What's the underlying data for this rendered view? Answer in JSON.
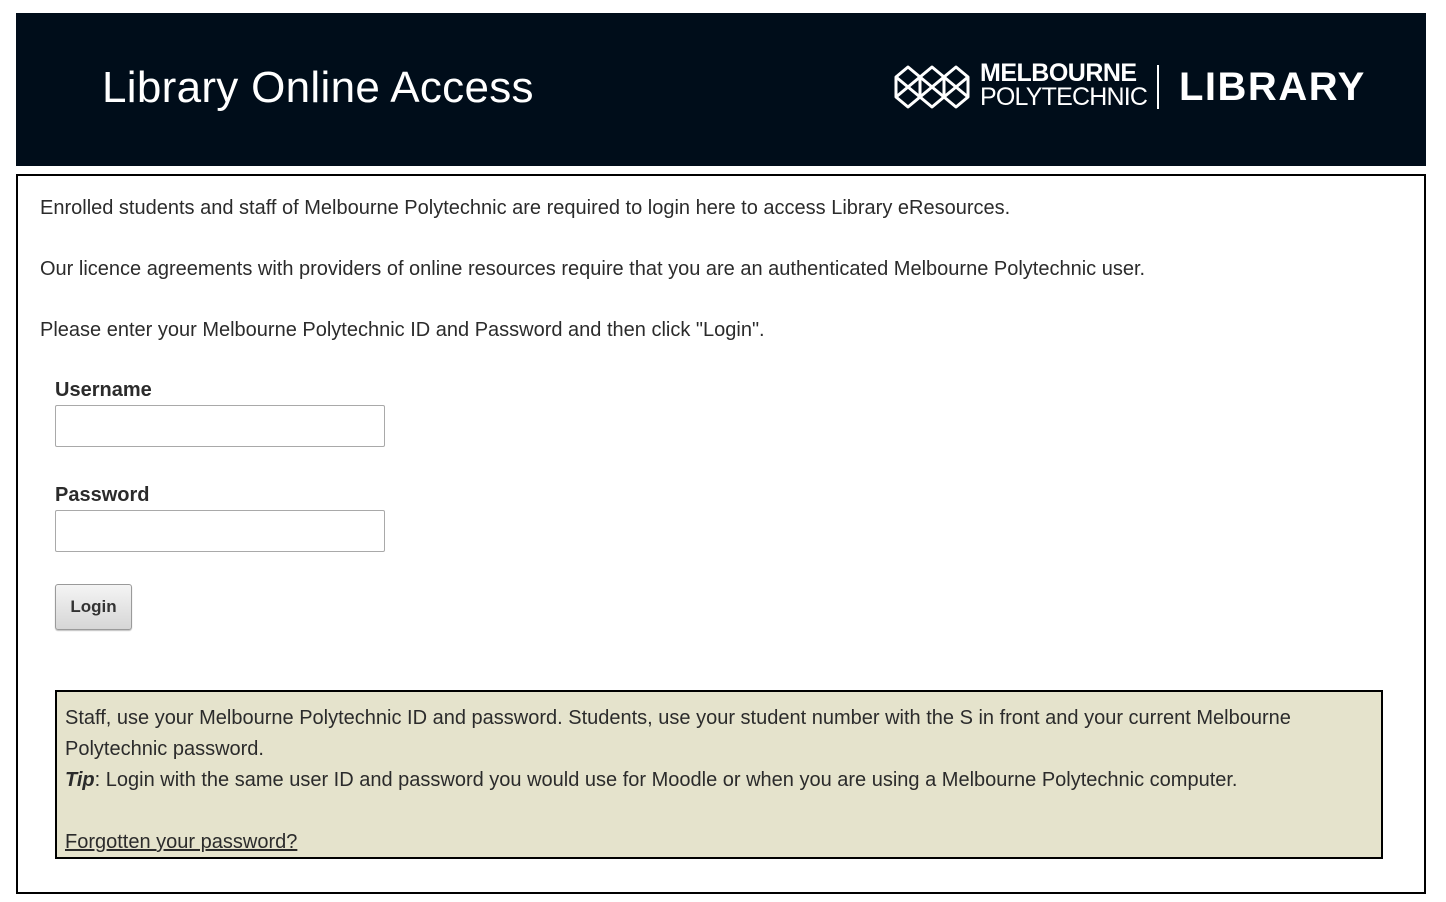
{
  "header": {
    "title": "Library Online Access",
    "logo": {
      "line1": "MELBOURNE",
      "line2": "POLYTECHNIC",
      "library": "LIBRARY",
      "mark_icon": "melbourne-polytechnic-logo-mark"
    }
  },
  "intro": {
    "p1": "Enrolled students and staff of Melbourne Polytechnic are required to login here to access Library eResources.",
    "p2": "Our licence agreements with providers of online resources require that you are an authenticated Melbourne Polytechnic user.",
    "p3": "Please enter your Melbourne Polytechnic ID and Password and then click \"Login\"."
  },
  "form": {
    "username_label": "Username",
    "username_value": "",
    "password_label": "Password",
    "password_value": "",
    "login_label": "Login"
  },
  "info": {
    "staff_text": "Staff, use your Melbourne Polytechnic ID and password. Students, use your student number with the S in front and your current Melbourne Polytechnic password.",
    "tip_word": "Tip",
    "tip_text": ": Login with the same user ID and password you would use for Moodle or when you are using a Melbourne Polytechnic computer.",
    "forgot_link": "Forgotten your password?"
  },
  "colors": {
    "header_bg": "#000d1a",
    "info_bg": "#e5e3cc",
    "text": "#2b2b2b"
  }
}
